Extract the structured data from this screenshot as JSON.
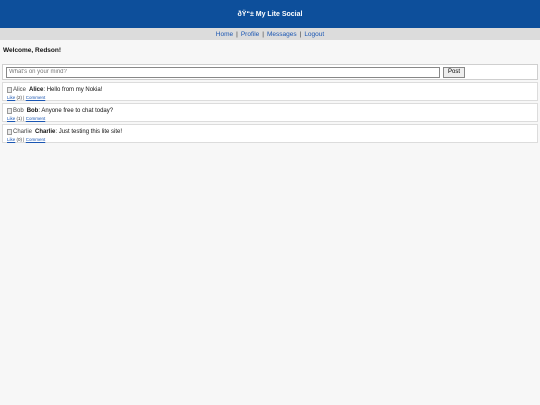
{
  "header": {
    "title": "ðŸ“± My Lite Social"
  },
  "nav": {
    "home": "Home",
    "profile": "Profile",
    "messages": "Messages",
    "logout": "Logout",
    "separator": "|"
  },
  "welcome": "Welcome, Redson!",
  "composer": {
    "placeholder": "What's on your mind?",
    "value": "",
    "post_label": "Post"
  },
  "posts": [
    {
      "avatar_alt": "Alice",
      "author": "Alice",
      "text": ": Hello from my Nokia!",
      "like": "Like",
      "count": "(2)",
      "separator": "|",
      "comment": "Comment"
    },
    {
      "avatar_alt": "Bob",
      "author": "Bob",
      "text": ": Anyone free to chat today?",
      "like": "Like",
      "count": "(1)",
      "separator": "|",
      "comment": "Comment"
    },
    {
      "avatar_alt": "Charlie",
      "author": "Charlie",
      "text": ": Just testing this lite site!",
      "like": "Like",
      "count": "(0)",
      "separator": "|",
      "comment": "Comment"
    }
  ]
}
